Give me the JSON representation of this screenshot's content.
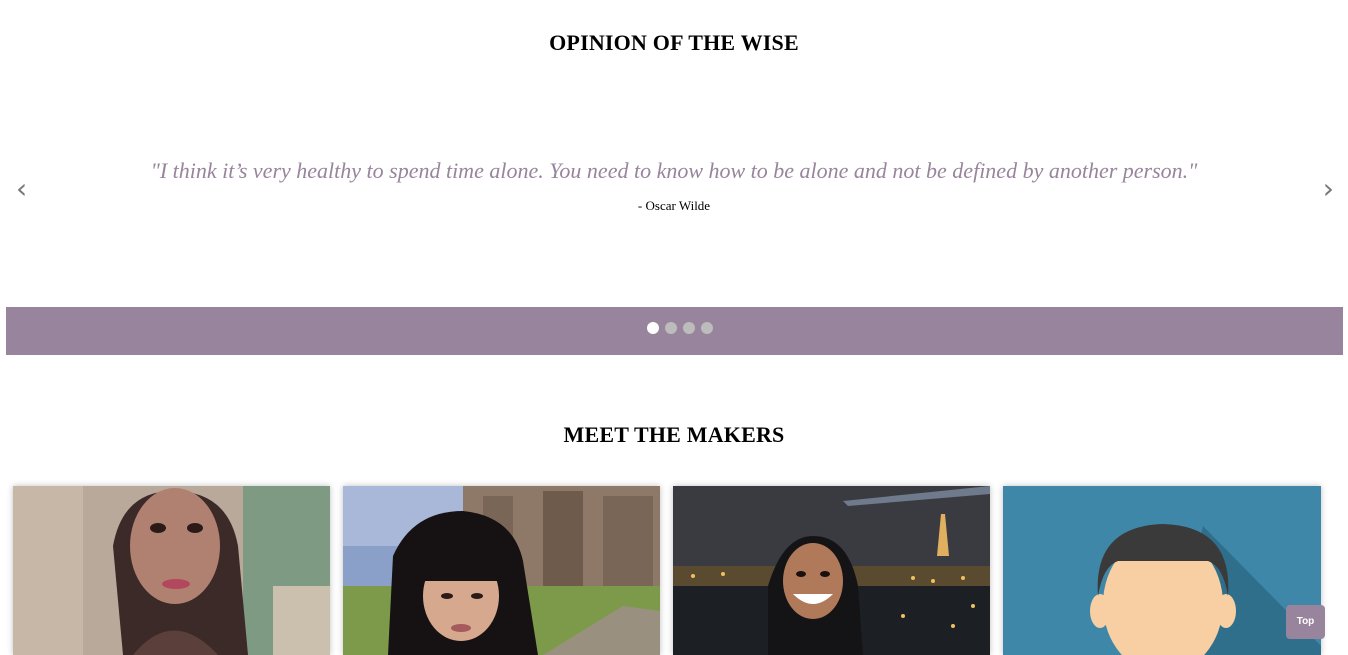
{
  "wise_section": {
    "title": "OPINION OF THE WISE",
    "quote": "\"I think it’s very healthy to spend time alone. You need to know how to be alone and not be defined by another person.\"",
    "author": "- Oscar Wilde",
    "prev_icon": "‹",
    "next_icon": "›",
    "slide_count": 4,
    "active_slide": 1
  },
  "makers_section": {
    "title": "MEET THE MAKERS",
    "makers": [
      {
        "photo": "maker-photo-1"
      },
      {
        "photo": "maker-photo-2"
      },
      {
        "photo": "maker-photo-3"
      },
      {
        "photo": "maker-avatar-placeholder"
      }
    ]
  },
  "top_button": {
    "label": "Top"
  },
  "colors": {
    "accent": "#98849c",
    "dot_active": "#ffffff",
    "dot_inactive": "#bcbcbc"
  }
}
